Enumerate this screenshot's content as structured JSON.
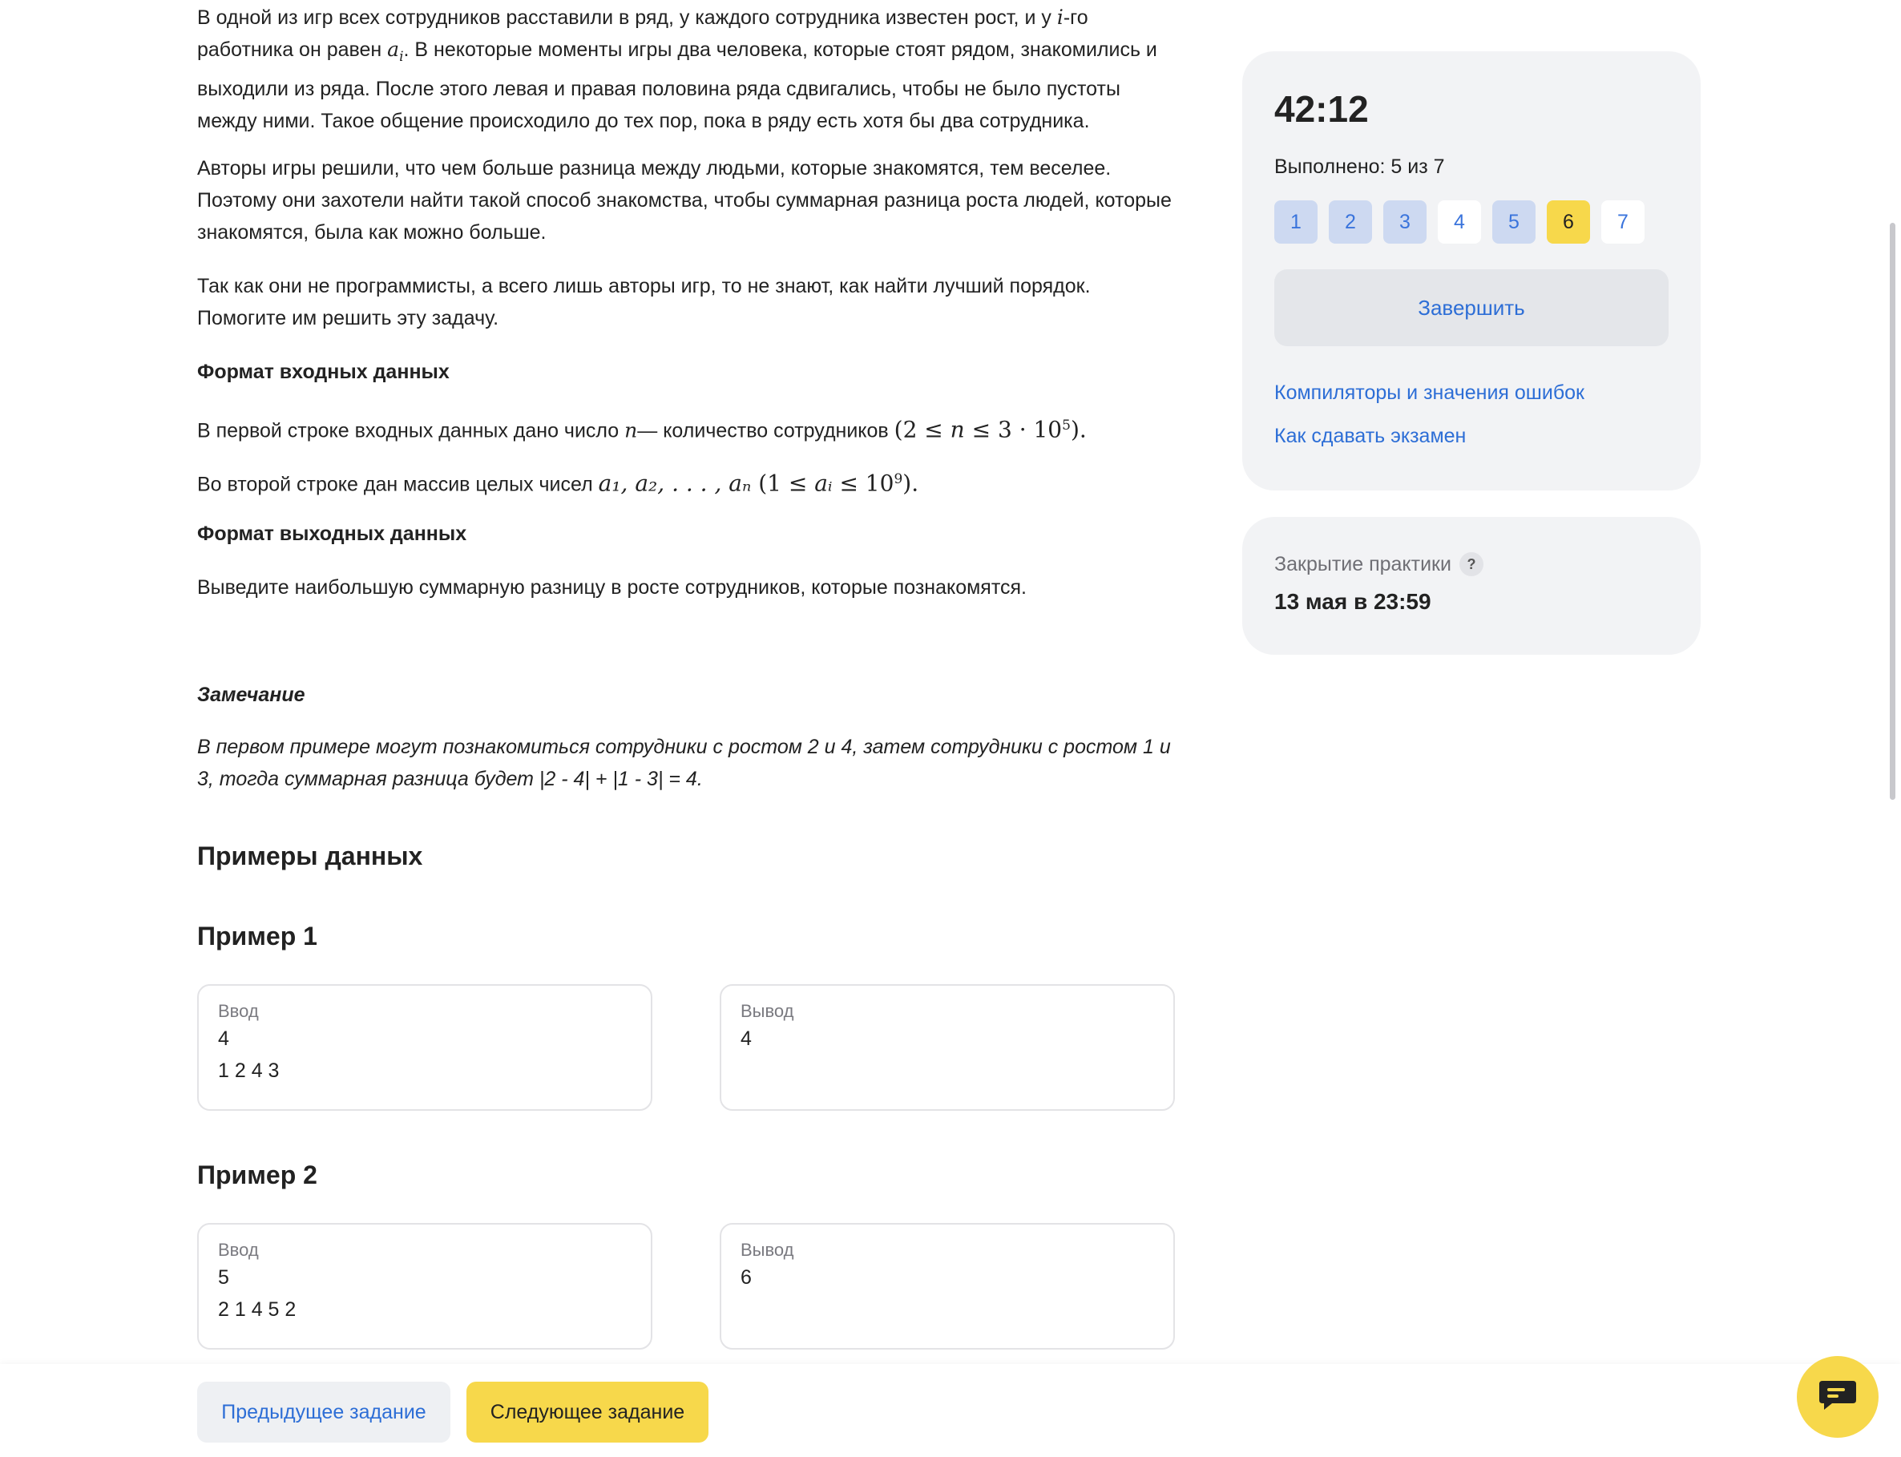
{
  "problem": {
    "paragraph1": {
      "t1": "В одной из игр всех сотрудников расставили в ряд, у каждого сотрудника известен рост, и у ",
      "i_var": "i",
      "t2": "-го работника он равен ",
      "a_var": "a",
      "a_sub": "i",
      "t3": ". В некоторые моменты игры два человека, которые стоят рядом, знакомились и выходили из ряда. После этого левая и правая половина ряда сдвигались, чтобы не было пустоты между ними. Такое общение происходило до тех пор, пока в ряду есть хотя бы два сотрудника."
    },
    "paragraph2": "Авторы игры решили, что чем больше разница между людьми, которые знакомятся, тем веселее. Поэтому они захотели найти такой способ знакомства, чтобы суммарная разница роста людей, которые знакомятся, была как можно больше.",
    "paragraph3": "Так как они не программисты, а всего лишь авторы игр, то не знают, как найти лучший порядок. Помогите им решить эту задачу.",
    "input_format_title": "Формат входных данных",
    "input_line1": {
      "text": "В первой строке входных данных дано число ",
      "var": "n",
      "dash": "— ",
      "rest": "количество сотрудников ",
      "math_pre": "(2 ≤ ",
      "math_var": "n",
      "math_mid": " ≤ 3 · 10",
      "math_exp": "5",
      "math_post": ")."
    },
    "input_line2": {
      "text": "Во второй строке дан массив целых чисел ",
      "seq": "a₁, a₂, . . . , aₙ",
      "math_pre": " (1 ≤ ",
      "math_var": "aᵢ",
      "math_mid": " ≤ 10",
      "math_exp": "9",
      "math_post": ")."
    },
    "output_format_title": "Формат выходных данных",
    "output_text": "Выведите наибольшую суммарную разницу в росте сотрудников, которые познакомятся.",
    "note_title": "Замечание",
    "note_text": "В первом примере могут познакомиться сотрудники с ростом 2 и 4, затем сотрудники с ростом 1 и 3, тогда суммарная разница будет |2 - 4| + |1 - 3| = 4.",
    "examples_title": "Примеры данных",
    "examples": [
      {
        "title": "Пример 1",
        "input_label": "Ввод",
        "input_lines": [
          "4",
          "1 2 4 3"
        ],
        "output_label": "Вывод",
        "output_lines": [
          "4"
        ]
      },
      {
        "title": "Пример 2",
        "input_label": "Ввод",
        "input_lines": [
          "5",
          "2 1 4 5 2"
        ],
        "output_label": "Вывод",
        "output_lines": [
          "6"
        ]
      }
    ]
  },
  "sidebar": {
    "timer": "42:12",
    "progress": "Выполнено: 5 из 7",
    "tasks": [
      {
        "label": "1",
        "state": "done"
      },
      {
        "label": "2",
        "state": "done"
      },
      {
        "label": "3",
        "state": "done"
      },
      {
        "label": "4",
        "state": "todo"
      },
      {
        "label": "5",
        "state": "done"
      },
      {
        "label": "6",
        "state": "current"
      },
      {
        "label": "7",
        "state": "todo"
      }
    ],
    "finish_label": "Завершить",
    "link_compilers": "Компиляторы и значения ошибок",
    "link_how_to": "Как сдавать экзамен",
    "deadline_label": "Закрытие практики",
    "deadline_help": "?",
    "deadline_value": "13 мая в 23:59"
  },
  "footer": {
    "prev_label": "Предыдущее задание",
    "next_label": "Следующее задание"
  },
  "colors": {
    "accent_yellow": "#f7d84b",
    "link_blue": "#2d6ed6",
    "done_task_bg": "#cdd9f1",
    "panel_bg": "#f2f3f5"
  },
  "icons": {
    "chat": "chat-icon"
  }
}
